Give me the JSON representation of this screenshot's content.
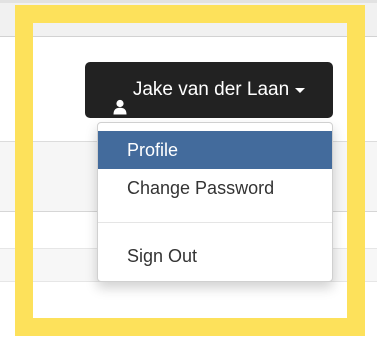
{
  "user_menu": {
    "username": "Jake van der Laan",
    "user_icon": "user-icon",
    "caret_icon": "caret-down-icon"
  },
  "dropdown": {
    "items": [
      {
        "label": "Profile",
        "active": true
      },
      {
        "label": "Change Password",
        "active": false
      },
      {
        "label": "Sign Out",
        "active": false
      }
    ]
  },
  "colors": {
    "button_bg": "#222222",
    "active_item_bg": "#436b9c",
    "highlight_frame": "#fde15b"
  }
}
